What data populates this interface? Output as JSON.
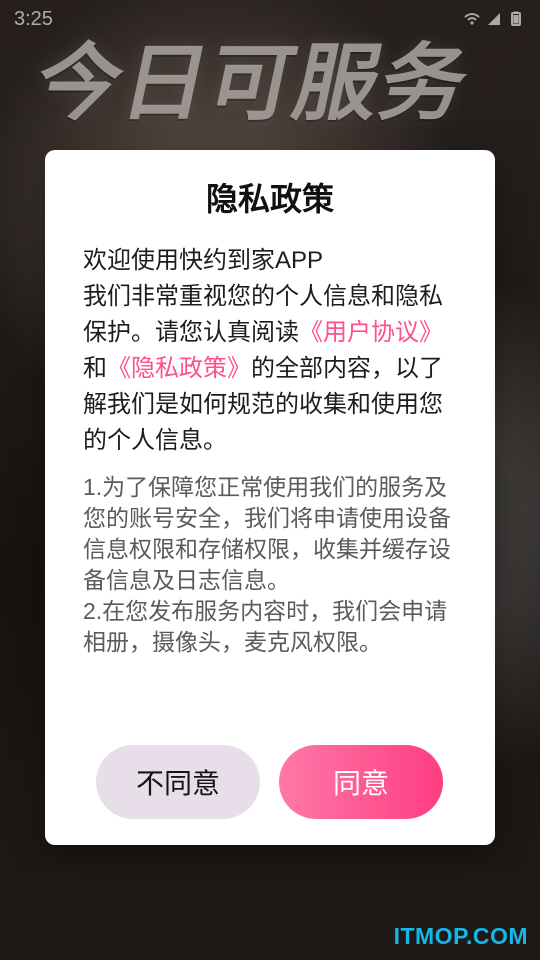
{
  "status_bar": {
    "time": "3:25",
    "icons": [
      "wifi-icon",
      "signal-icon",
      "battery-icon"
    ]
  },
  "background": {
    "title_text": "今日可服务"
  },
  "dialog": {
    "title": "隐私政策",
    "intro_line_1": "欢迎使用快约到家APP",
    "intro_line_2_prefix": "我们非常重视您的个人信息和隐私保护。请您认真阅读",
    "link_user_agreement": "《用户协议》",
    "intro_and": "和",
    "link_privacy_policy": "《隐私政策》",
    "intro_line_2_suffix": "的全部内容，以了解我们是如何规范的收集和使用您的个人信息。",
    "notice_1": "1.为了保障您正常使用我们的服务及您的账号安全，我们将申请使用设备信息权限和存储权限，收集并缓存设备信息及日志信息。",
    "notice_2": "2.在您发布服务内容时，我们会申请相册，摄像头，麦克风权限。",
    "buttons": {
      "disagree": "不同意",
      "agree": "同意"
    }
  },
  "watermark": {
    "text": "ITMOP.COM"
  },
  "colors": {
    "accent_pink": "#ff4f8f",
    "agree_gradient_start": "#ff78a8",
    "agree_gradient_end": "#ff3d82",
    "disagree_bg": "#e7deea",
    "watermark": "#16b7e7"
  }
}
